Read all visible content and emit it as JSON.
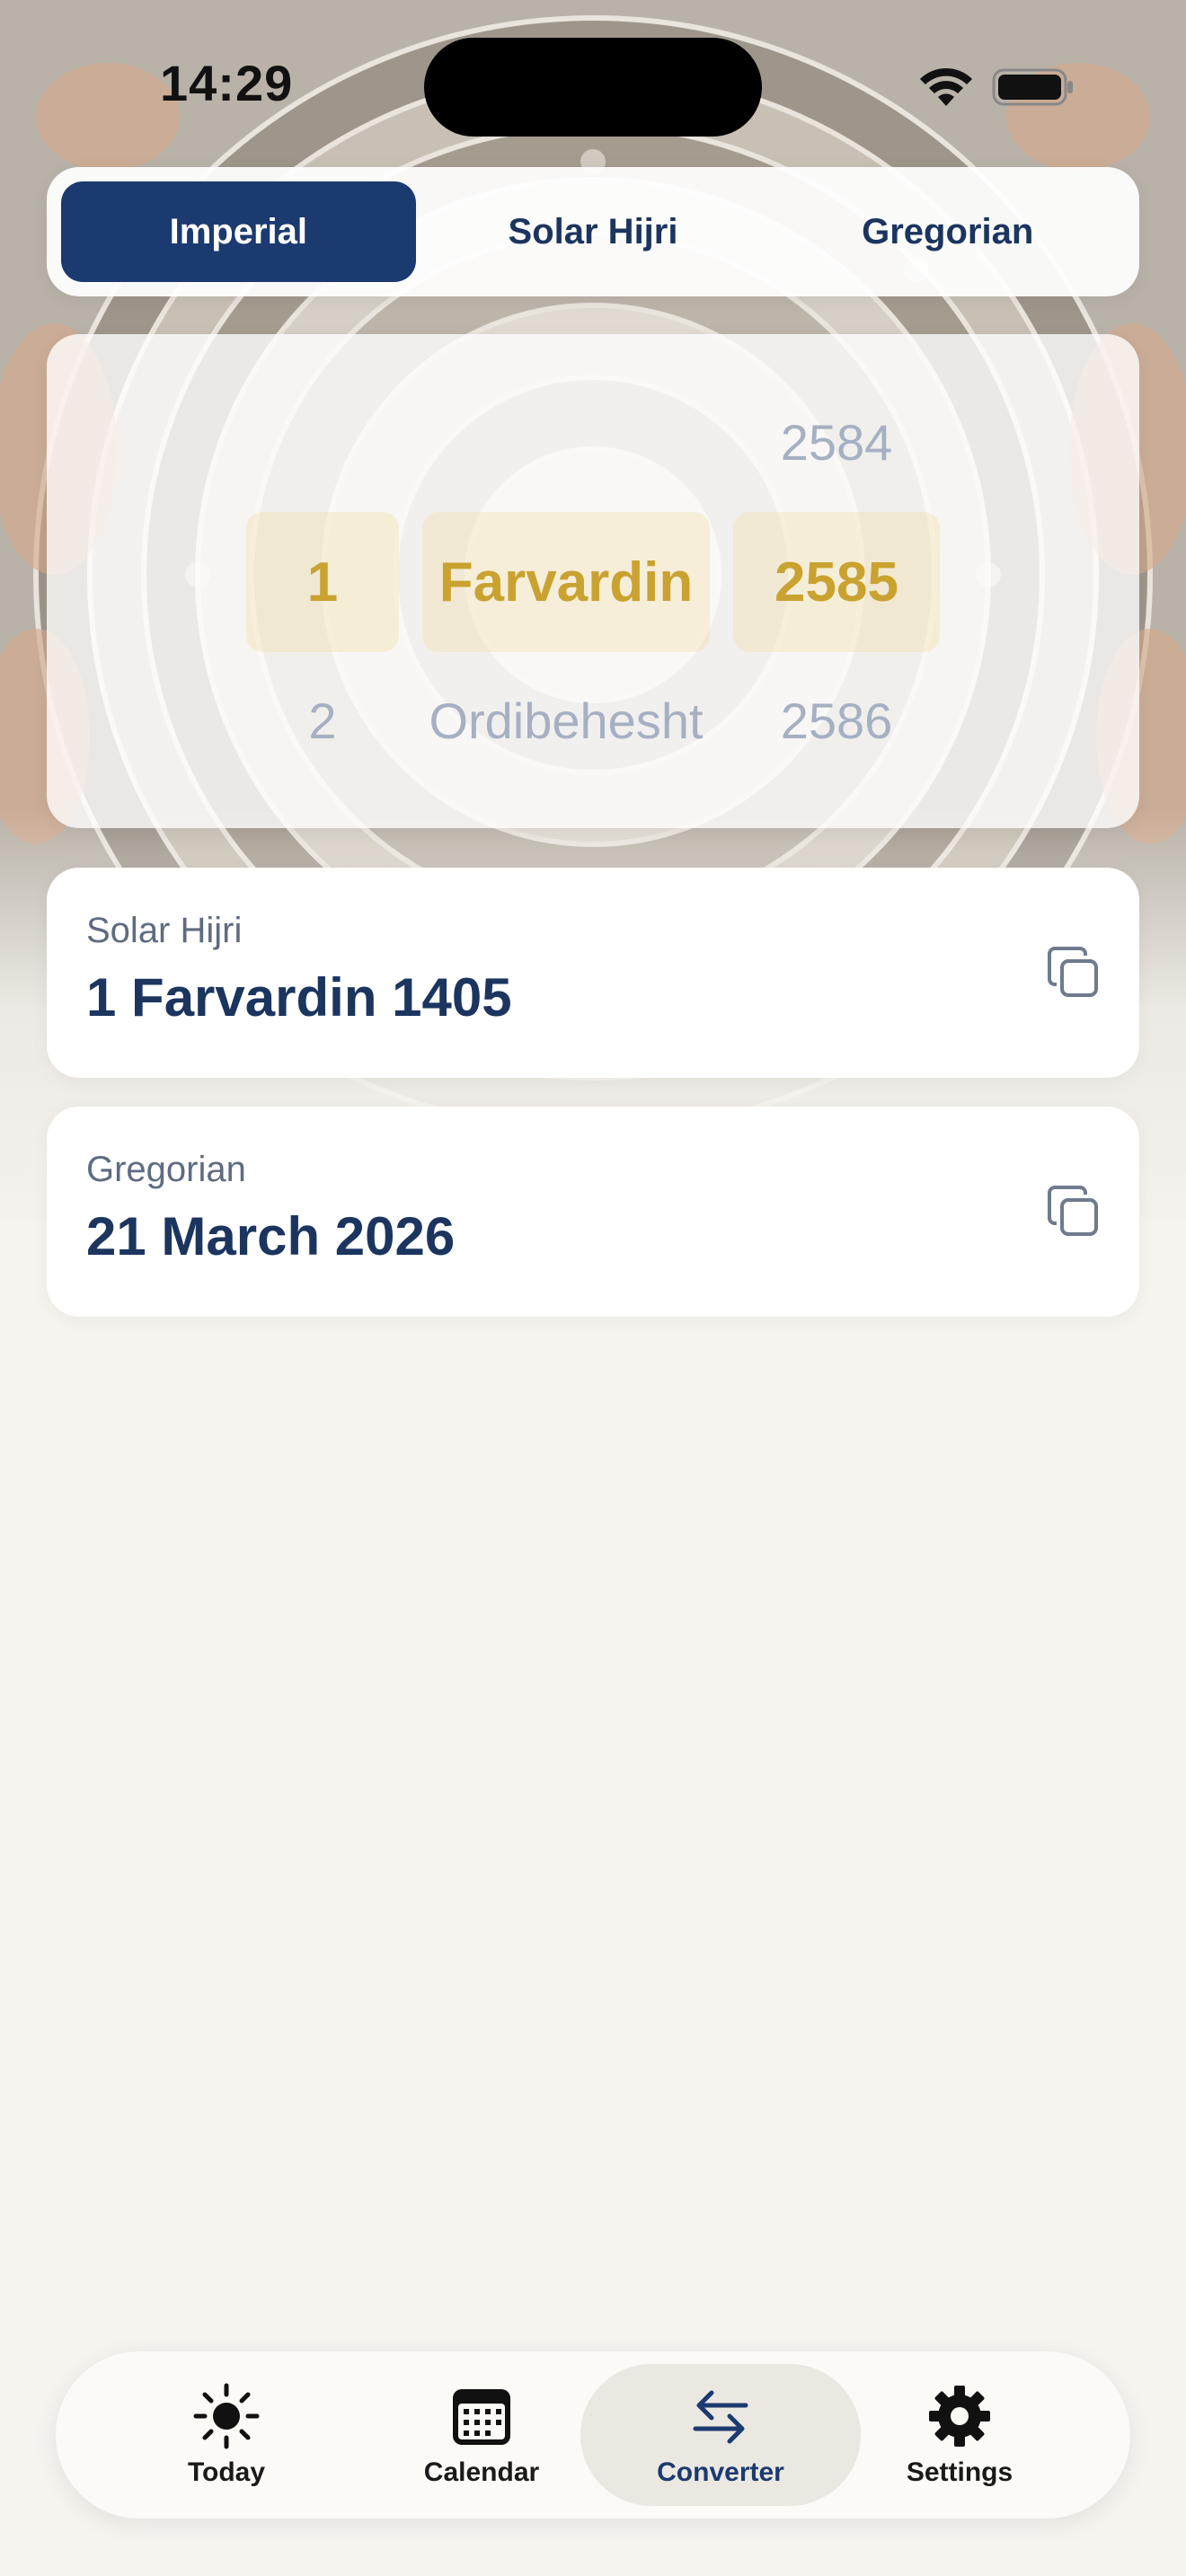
{
  "status_bar": {
    "time": "14:29"
  },
  "calendar_system_tabs": [
    {
      "label": "Imperial",
      "active": true
    },
    {
      "label": "Solar Hijri",
      "active": false
    },
    {
      "label": "Gregorian",
      "active": false
    }
  ],
  "picker": {
    "day": {
      "prev": "",
      "selected": "1",
      "next": "2"
    },
    "month": {
      "prev": "",
      "selected": "Farvardin",
      "next": "Ordibehesht"
    },
    "year": {
      "prev": "2584",
      "selected": "2585",
      "next": "2586"
    }
  },
  "results": [
    {
      "label": "Solar Hijri",
      "value": "1 Farvardin 1405",
      "icon": "copy-icon"
    },
    {
      "label": "Gregorian",
      "value": "21 March 2026",
      "icon": "copy-icon"
    }
  ],
  "tab_bar": [
    {
      "label": "Today",
      "icon": "sun-icon",
      "active": false
    },
    {
      "label": "Calendar",
      "icon": "calendar-icon",
      "active": false
    },
    {
      "label": "Converter",
      "icon": "arrows-exchange-icon",
      "active": true
    },
    {
      "label": "Settings",
      "icon": "gear-icon",
      "active": false
    }
  ],
  "colors": {
    "accent": "#1b3a70",
    "gold": "#c9a230",
    "background": "#f6f4ef",
    "muted": "#a6b0c3"
  }
}
